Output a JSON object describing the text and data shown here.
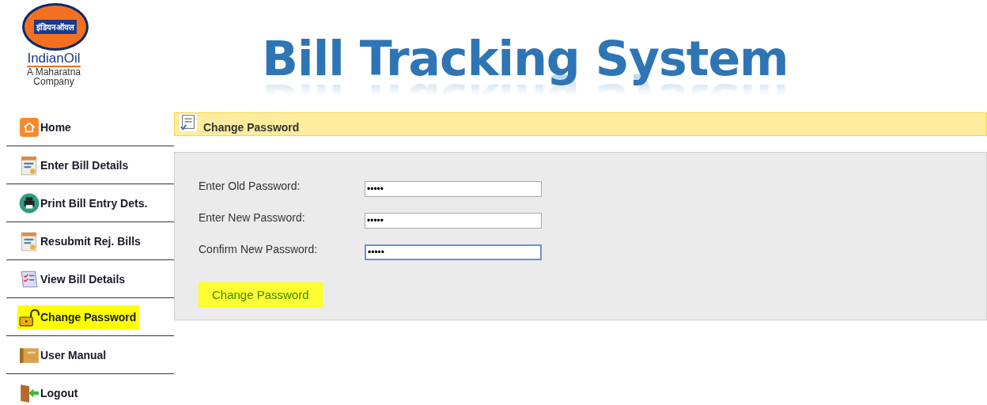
{
  "logo": {
    "hindi": "इंडियनऑयल",
    "brand": "IndianOil",
    "tagline": [
      "A Maharatna",
      "Company"
    ]
  },
  "header": {
    "title": "Bill Tracking System"
  },
  "sidebar": {
    "items": [
      {
        "label": "Home",
        "kind": "home",
        "selected": false
      },
      {
        "label": "Enter Bill Details",
        "kind": "form",
        "selected": false
      },
      {
        "label": "Print Bill Entry Dets.",
        "kind": "print",
        "selected": false
      },
      {
        "label": "Resubmit Rej. Bills",
        "kind": "form",
        "selected": false
      },
      {
        "label": "View Bill Details",
        "kind": "list",
        "selected": false
      },
      {
        "label": "Change Password",
        "kind": "lock",
        "selected": true
      },
      {
        "label": "User Manual",
        "kind": "book",
        "selected": false
      },
      {
        "label": "Logout",
        "kind": "logout",
        "selected": false
      }
    ]
  },
  "panel": {
    "title": "Change Password",
    "fields": [
      {
        "label": "Enter Old Password:",
        "value": "•••••",
        "focused": false
      },
      {
        "label": "Enter New Password:",
        "value": "•••••",
        "focused": false
      },
      {
        "label": "Confirm New Password:",
        "value": "•••••",
        "focused": true
      }
    ],
    "submit": {
      "label": "Change Password",
      "highlighted": true
    }
  }
}
